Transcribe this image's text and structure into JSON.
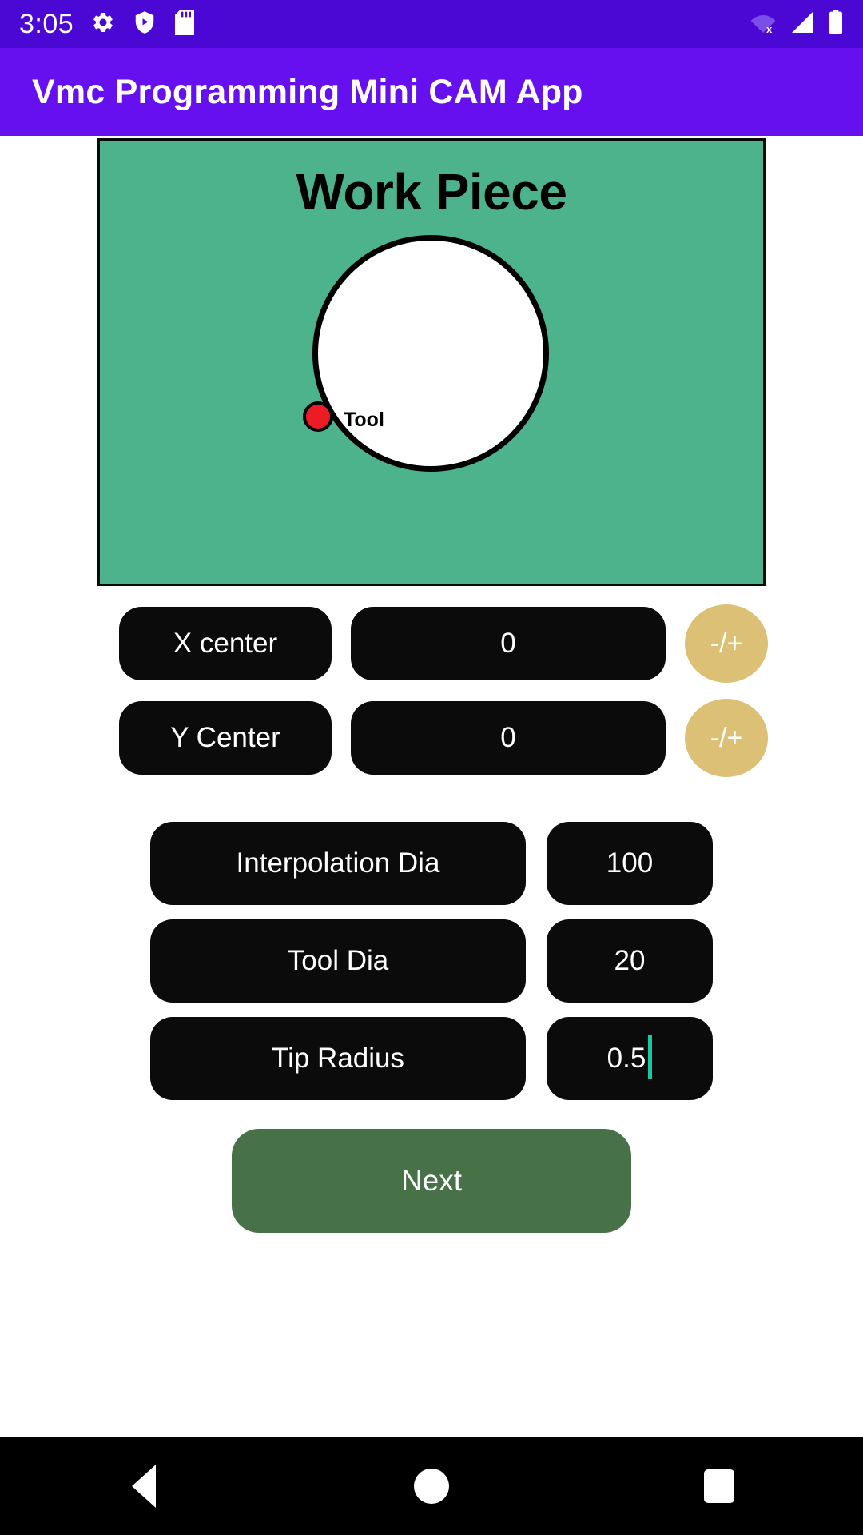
{
  "status_bar": {
    "time": "3:05",
    "left_icons": [
      "gear-icon",
      "shield-play-icon",
      "sd-card-icon"
    ],
    "right_icons": [
      "wifi-off-icon",
      "cellular-signal-icon",
      "battery-icon"
    ],
    "background_color": "#4B08D4"
  },
  "app_bar": {
    "title": "Vmc Programming Mini CAM App",
    "background_color": "#6610F0",
    "text_color": "#FFFFFF"
  },
  "workpiece": {
    "title": "Work Piece",
    "tool_label": "Tool",
    "background_color": "#4DB38C",
    "circle_fill": "#FFFFFF",
    "circle_stroke": "#000000",
    "tool_color": "#EC1C24"
  },
  "center_fields": [
    {
      "label": "X center",
      "value": "0",
      "toggle_label": "-/+"
    },
    {
      "label": "Y Center",
      "value": "0",
      "toggle_label": "-/+"
    }
  ],
  "param_fields": [
    {
      "label": "Interpolation Dia",
      "value": "100"
    },
    {
      "label": "Tool Dia",
      "value": "20"
    },
    {
      "label": "Tip Radius",
      "value": "0.5"
    }
  ],
  "next_button": {
    "label": "Next",
    "color": "#477247"
  },
  "colors": {
    "pill_bg": "#0B0B0B",
    "toggle_bg": "#DCC076",
    "caret": "#18C8A0"
  },
  "nav_bar": {
    "back": "back-triangle-icon",
    "home": "home-circle-icon",
    "recents": "recents-square-icon"
  }
}
